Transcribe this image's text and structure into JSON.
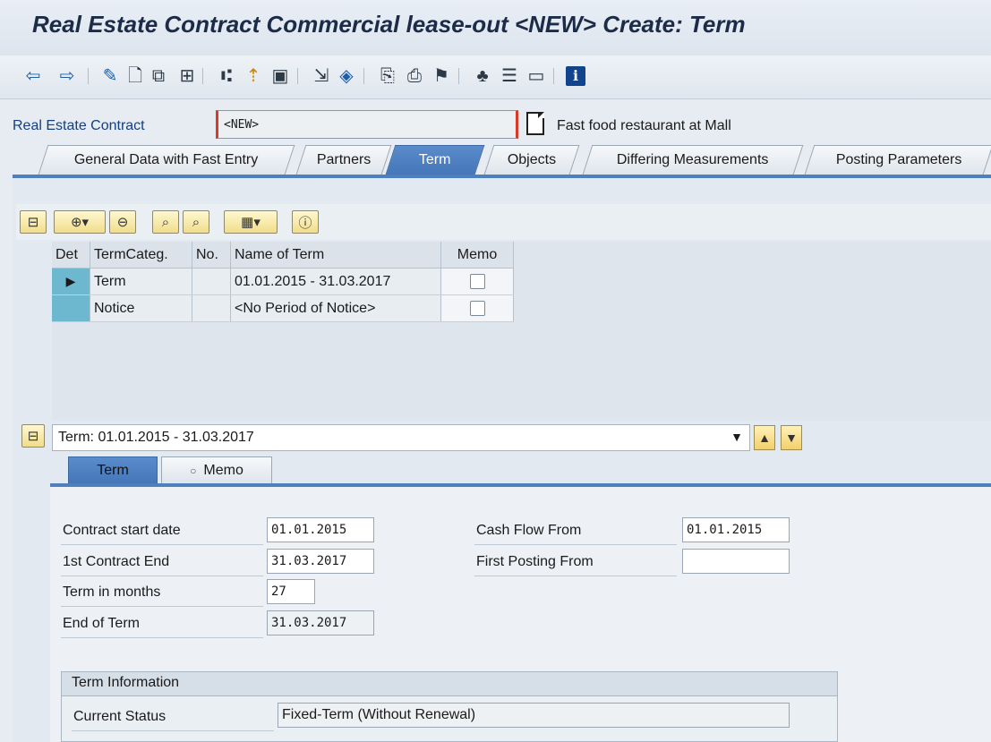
{
  "window": {
    "title": "Real Estate Contract Commercial lease-out <NEW> Create: Term"
  },
  "toolbar": {
    "icons": [
      "back-arrow-icon",
      "forward-arrow-icon",
      "edit-pencil-icon",
      "new-document-icon",
      "copy-icon",
      "display-change-icon",
      "hierarchy-icon",
      "pin-icon",
      "save-icon",
      "object-link-icon",
      "eraser-icon",
      "attach-icon",
      "print-icon",
      "flag-icon",
      "org-structure-icon",
      "list-icon",
      "layout-icon",
      "info-icon"
    ]
  },
  "header": {
    "label": "Real Estate Contract",
    "value": "<NEW>",
    "description": "Fast food restaurant at Mall"
  },
  "tabs": [
    {
      "label": "General Data with Fast Entry",
      "active": false
    },
    {
      "label": "Partners",
      "active": false
    },
    {
      "label": "Term",
      "active": true
    },
    {
      "label": "Objects",
      "active": false
    },
    {
      "label": "Differing Measurements",
      "active": false
    },
    {
      "label": "Posting Parameters",
      "active": false
    }
  ],
  "term_table": {
    "columns": [
      "Det",
      "TermCateg.",
      "No.",
      "Name of Term",
      "Memo"
    ],
    "rows": [
      {
        "category": "Term",
        "no": "",
        "name": "01.01.2015 - 31.03.2017",
        "memo": false
      },
      {
        "category": "Notice",
        "no": "",
        "name": "<No Period of Notice>",
        "memo": false
      }
    ]
  },
  "detail": {
    "selector_value": "Term: 01.01.2015 - 31.03.2017",
    "subtabs": [
      {
        "label": "Term",
        "active": true
      },
      {
        "label": "Memo",
        "active": false
      }
    ],
    "fields": {
      "contract_start_label": "Contract start date",
      "contract_start_value": "01.01.2015",
      "first_end_label": "1st Contract End",
      "first_end_value": "31.03.2017",
      "term_months_label": "Term in months",
      "term_months_value": "27",
      "end_of_term_label": "End of Term",
      "end_of_term_value": "31.03.2017",
      "cash_flow_label": "Cash Flow From",
      "cash_flow_value": "01.01.2015",
      "first_posting_label": "First Posting From",
      "first_posting_value": ""
    },
    "term_information": {
      "title": "Term Information",
      "status_label": "Current Status",
      "status_value": "Fixed-Term (Without Renewal)"
    }
  },
  "colors": {
    "accent_blue": "#4f80be",
    "header_label_blue": "#133f80",
    "required_marker_red": "#d93a26",
    "selected_row": "#6db7cf"
  }
}
